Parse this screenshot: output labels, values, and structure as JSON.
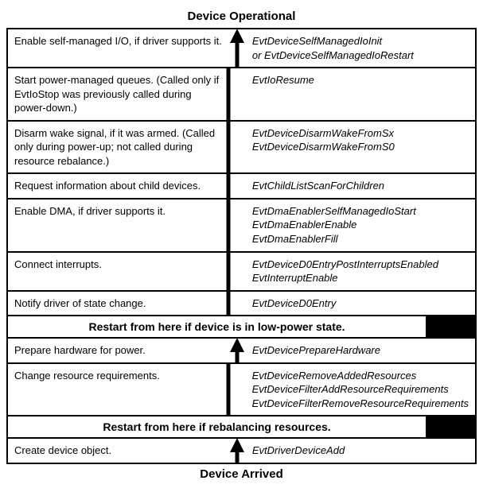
{
  "title_top": "Device Operational",
  "title_bottom": "Device Arrived",
  "rows_group1": [
    {
      "action": "Enable self-managed I/O, if driver supports it.",
      "callbacks": [
        "EvtDeviceSelfManagedIoInit",
        "or EvtDeviceSelfManagedIoRestart"
      ]
    },
    {
      "action": "Start power-managed queues. (Called only if EvtIoStop was previously called during power-down.)",
      "callbacks": [
        "EvtIoResume"
      ]
    },
    {
      "action": "Disarm wake signal, if it was armed. (Called only during power-up; not called during resource rebalance.)",
      "callbacks": [
        "EvtDeviceDisarmWakeFromSx",
        "EvtDeviceDisarmWakeFromS0"
      ]
    },
    {
      "action": "Request information about child devices.",
      "callbacks": [
        "EvtChildListScanForChildren"
      ]
    },
    {
      "action": "Enable DMA, if driver supports it.",
      "callbacks": [
        "EvtDmaEnablerSelfManagedIoStart",
        "EvtDmaEnablerEnable",
        "EvtDmaEnablerFill"
      ]
    },
    {
      "action": "Connect interrupts.",
      "callbacks": [
        "EvtDeviceD0EntryPostInterruptsEnabled",
        "EvtInterruptEnable"
      ]
    },
    {
      "action": "Notify driver of state change.",
      "callbacks": [
        "EvtDeviceD0Entry"
      ]
    }
  ],
  "banner1": "Restart from here if device is in low-power state.",
  "rows_group2": [
    {
      "action": "Prepare hardware for power.",
      "callbacks": [
        "EvtDevicePrepareHardware"
      ]
    },
    {
      "action": "Change resource requirements.",
      "callbacks": [
        "EvtDeviceRemoveAddedResources",
        "EvtDeviceFilterAddResourceRequirements",
        "EvtDeviceFilterRemoveResourceRequirements"
      ]
    }
  ],
  "banner2": "Restart from here if rebalancing resources.",
  "rows_group3": [
    {
      "action": "Create device object.",
      "callbacks": [
        "EvtDriverDeviceAdd"
      ]
    }
  ]
}
